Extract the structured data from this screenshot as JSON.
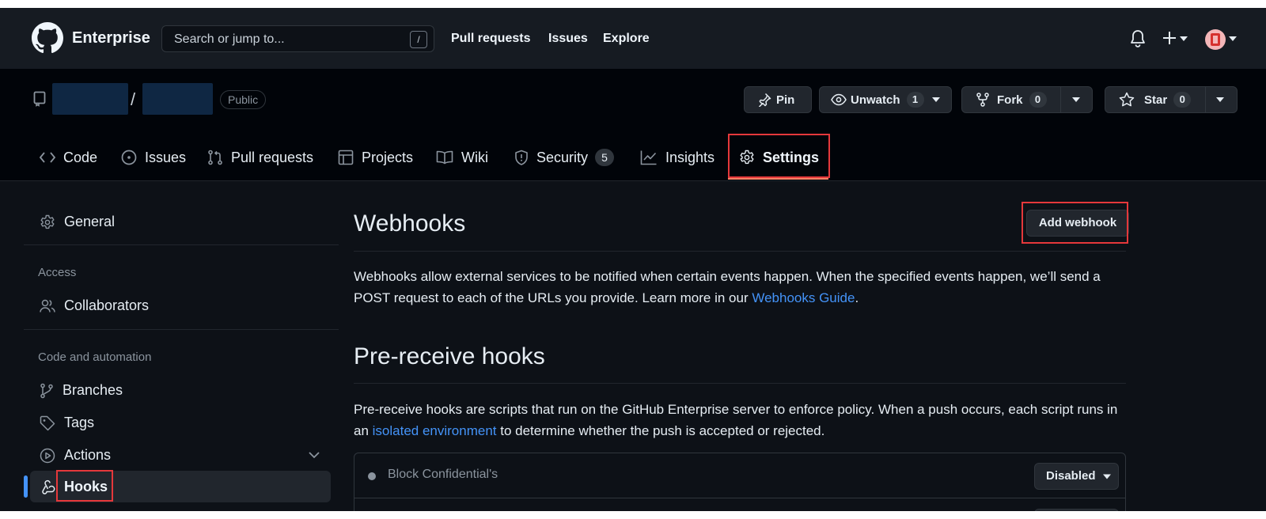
{
  "header": {
    "brand": "Enterprise",
    "search_placeholder": "Search or jump to...",
    "search_shortcut": "/",
    "nav": [
      "Pull requests",
      "Issues",
      "Explore"
    ]
  },
  "repo": {
    "visibility": "Public",
    "slash": "/",
    "pin_label": "Pin",
    "unwatch_label": "Unwatch",
    "unwatch_count": "1",
    "fork_label": "Fork",
    "fork_count": "0",
    "star_label": "Star",
    "star_count": "0"
  },
  "tabs": [
    {
      "label": "Code"
    },
    {
      "label": "Issues"
    },
    {
      "label": "Pull requests"
    },
    {
      "label": "Projects"
    },
    {
      "label": "Wiki"
    },
    {
      "label": "Security",
      "badge": "5"
    },
    {
      "label": "Insights"
    },
    {
      "label": "Settings"
    }
  ],
  "sidebar": {
    "general": "General",
    "access_heading": "Access",
    "collaborators": "Collaborators",
    "code_heading": "Code and automation",
    "branches": "Branches",
    "tags": "Tags",
    "actions": "Actions",
    "hooks": "Hooks"
  },
  "main": {
    "webhooks_title": "Webhooks",
    "add_webhook": "Add webhook",
    "webhooks_desc_1": "Webhooks allow external services to be notified when certain events happen. When the specified events happen, we’ll send a POST request to each of the URLs you provide. Learn more in our ",
    "webhooks_link": "Webhooks Guide",
    "webhooks_desc_end": ".",
    "prereceive_title": "Pre-receive hooks",
    "prereceive_desc_1": "Pre-receive hooks are scripts that run on the GitHub Enterprise server to enforce policy. When a push occurs, each script runs in an ",
    "prereceive_link": "isolated environment",
    "prereceive_desc_2": " to determine whether the push is accepted or rejected.",
    "hooks": [
      {
        "name": "Block Confidential's",
        "status": "Disabled"
      }
    ]
  },
  "colors": {
    "accent_link": "#4493f8",
    "highlight_box": "#e5383b",
    "active_bar": "#4493f8"
  }
}
